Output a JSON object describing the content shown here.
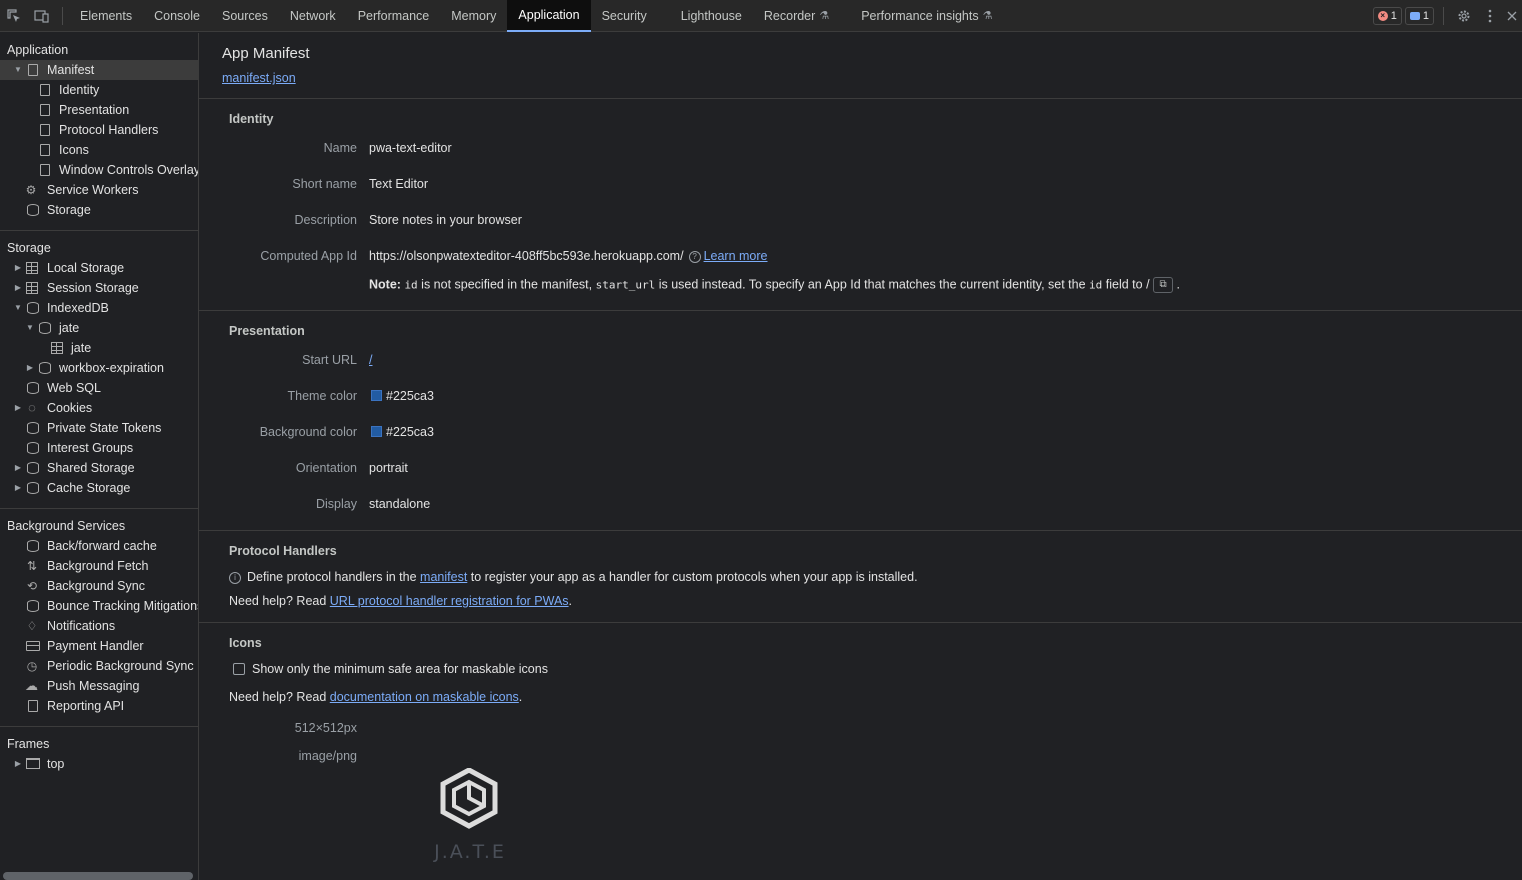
{
  "toolbar": {
    "tabs": [
      "Elements",
      "Console",
      "Sources",
      "Network",
      "Performance",
      "Memory",
      "Application",
      "Security",
      "Lighthouse",
      "Recorder",
      "Performance insights"
    ],
    "errors_count": "1",
    "messages_count": "1"
  },
  "sidebar": {
    "application_title": "Application",
    "application_items": [
      "Manifest",
      "Identity",
      "Presentation",
      "Protocol Handlers",
      "Icons",
      "Window Controls Overlay",
      "Service Workers",
      "Storage"
    ],
    "storage_title": "Storage",
    "storage_items": [
      "Local Storage",
      "Session Storage",
      "IndexedDB",
      "jate",
      "jate",
      "workbox-expiration",
      "Web SQL",
      "Cookies",
      "Private State Tokens",
      "Interest Groups",
      "Shared Storage",
      "Cache Storage"
    ],
    "background_title": "Background Services",
    "background_items": [
      "Back/forward cache",
      "Background Fetch",
      "Background Sync",
      "Bounce Tracking Mitigations",
      "Notifications",
      "Payment Handler",
      "Periodic Background Sync",
      "Push Messaging",
      "Reporting API"
    ],
    "frames_title": "Frames",
    "frames_items": [
      "top"
    ]
  },
  "main": {
    "title": "App Manifest",
    "manifest_link": "manifest.json",
    "identity": {
      "heading": "Identity",
      "name_label": "Name",
      "name_value": "pwa-text-editor",
      "short_name_label": "Short name",
      "short_name_value": "Text Editor",
      "description_label": "Description",
      "description_value": "Store notes in your browser",
      "app_id_label": "Computed App Id",
      "app_id_value": "https://olsonpwatexteditor-408ff5bc593e.herokuapp.com/",
      "learn_more": "Learn more",
      "note_bold": "Note:",
      "note_id": "id",
      "note_text1": "is not specified in the manifest,",
      "note_start_url": "start_url",
      "note_text2": "is used instead. To specify an App Id that matches the current identity, set the",
      "note_id2": "id",
      "note_text3": "field to /"
    },
    "presentation": {
      "heading": "Presentation",
      "start_url_label": "Start URL",
      "start_url_value": "/",
      "theme_color_label": "Theme color",
      "theme_color_value": "#225ca3",
      "bg_color_label": "Background color",
      "bg_color_value": "#225ca3",
      "orientation_label": "Orientation",
      "orientation_value": "portrait",
      "display_label": "Display",
      "display_value": "standalone"
    },
    "protocol": {
      "heading": "Protocol Handlers",
      "line1_pre": "Define protocol handlers in the",
      "line1_link": "manifest",
      "line1_post": "to register your app as a handler for custom protocols when your app is installed.",
      "line2_pre": "Need help? Read",
      "line2_link": "URL protocol handler registration for PWAs",
      "line2_post": "."
    },
    "icons": {
      "heading": "Icons",
      "checkbox_label": "Show only the minimum safe area for maskable icons",
      "help_pre": "Need help? Read",
      "help_link": "documentation on maskable icons",
      "help_post": ".",
      "size": "512×512px",
      "type": "image/png",
      "logo_text": "J.A.T.E"
    }
  }
}
